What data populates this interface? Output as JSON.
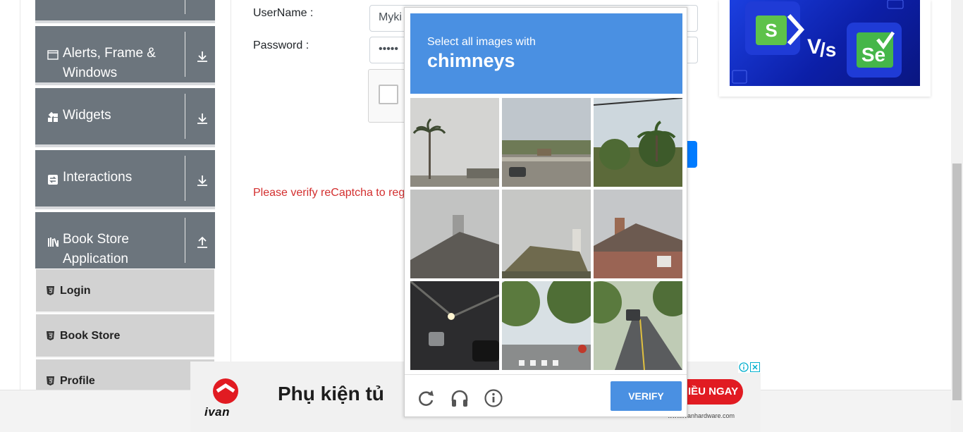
{
  "sidebar": {
    "groups": [
      {
        "label": "Alerts, Frame & Windows",
        "icon": "window-icon",
        "expanded": false
      },
      {
        "label": "Widgets",
        "icon": "widgets-icon",
        "expanded": false
      },
      {
        "label": "Interactions",
        "icon": "interactions-icon",
        "expanded": false
      },
      {
        "label": "Book Store Application",
        "icon": "books-icon",
        "expanded": true
      }
    ],
    "book_store_items": [
      {
        "label": "Login",
        "icon": "html5-icon"
      },
      {
        "label": "Book Store",
        "icon": "html5-icon"
      },
      {
        "label": "Profile",
        "icon": "html5-icon"
      }
    ]
  },
  "form": {
    "username_label": "UserName :",
    "username_value": "Myki",
    "password_label": "Password :",
    "password_value": "•••••",
    "error_message": "Please verify reCaptcha to regi"
  },
  "recaptcha": {
    "instruction": "Select all images with",
    "target": "chimneys",
    "tiles": [
      {
        "scene": "palm tree against grey sky"
      },
      {
        "scene": "highway bridge with cars"
      },
      {
        "scene": "palm trees and power line"
      },
      {
        "scene": "roof with tall chimney"
      },
      {
        "scene": "roof with chimney"
      },
      {
        "scene": "brick house with chimney"
      },
      {
        "scene": "road tunnel with cars"
      },
      {
        "scene": "tree-lined street crosswalk"
      },
      {
        "scene": "suburban road with car"
      }
    ],
    "verify_label": "VERIFY",
    "reload_icon": "reload-icon",
    "audio_icon": "headphones-icon",
    "info_icon": "info-icon"
  },
  "bottom_ad": {
    "headline": "Phụ kiện tủ",
    "cta": "IỀU NGAY",
    "brand": "ivan",
    "domain": "www.ivanhardware.com"
  },
  "colors": {
    "sidebar_group": "#6c757d",
    "sidebar_sub": "#d2d2d2",
    "recaptcha_blue": "#4a90e2",
    "error": "#d32f2f"
  }
}
